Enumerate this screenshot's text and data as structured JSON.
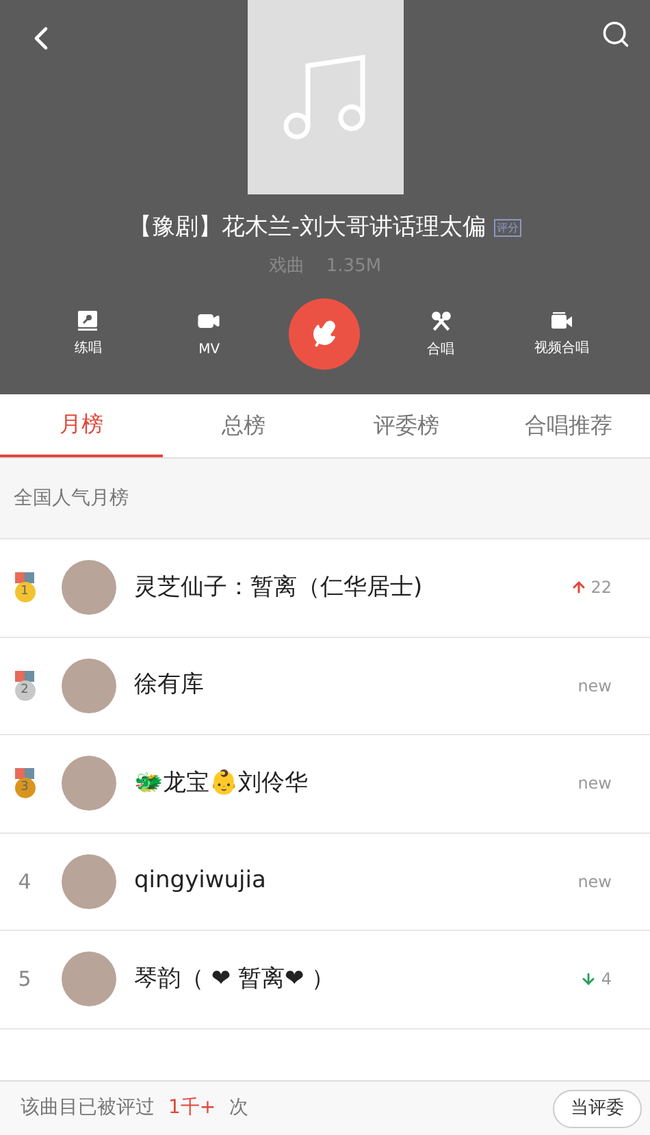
{
  "header": {
    "title": "【豫剧】花木兰-刘大哥讲话理太偏",
    "badge": "评分",
    "genre": "戏曲",
    "size": "1.35M",
    "actions": [
      {
        "kind": "practice",
        "label": "练唱"
      },
      {
        "kind": "mv",
        "label": "MV"
      },
      {
        "kind": "record"
      },
      {
        "kind": "duet",
        "label": "合唱"
      },
      {
        "kind": "video-duet",
        "label": "视频合唱"
      }
    ]
  },
  "tabs": [
    {
      "label": "月榜",
      "selected": true
    },
    {
      "label": "总榜",
      "selected": false
    },
    {
      "label": "评委榜",
      "selected": false
    },
    {
      "label": "合唱推荐",
      "selected": false
    }
  ],
  "section_title": "全国人气月榜",
  "rows": [
    {
      "rank": {
        "kind": "medal",
        "text": "1",
        "color": "#f2c230"
      },
      "name": "灵芝仙子：暂离（仁华居士)",
      "trend": {
        "kind": "up",
        "text": "22"
      }
    },
    {
      "rank": {
        "kind": "medal",
        "text": "2",
        "color": "#c8c8c8"
      },
      "name": "徐有库",
      "trend": {
        "kind": "plain",
        "text": "new"
      }
    },
    {
      "rank": {
        "kind": "medal",
        "text": "3",
        "color": "#d9951e"
      },
      "name": "🐲龙宝👶刘伶华",
      "trend": {
        "kind": "plain",
        "text": "new"
      }
    },
    {
      "rank": {
        "kind": "number",
        "text": "4"
      },
      "name": "qingyiwujia",
      "trend": {
        "kind": "plain",
        "text": "new"
      }
    },
    {
      "rank": {
        "kind": "number",
        "text": "5"
      },
      "name": "琴韵（ ❤ 暂离❤ ）",
      "trend": {
        "kind": "down",
        "text": "4"
      }
    }
  ],
  "footer": {
    "text": "该曲目已被评过",
    "count": "1千+",
    "suffix": "次",
    "button": "当评委"
  }
}
